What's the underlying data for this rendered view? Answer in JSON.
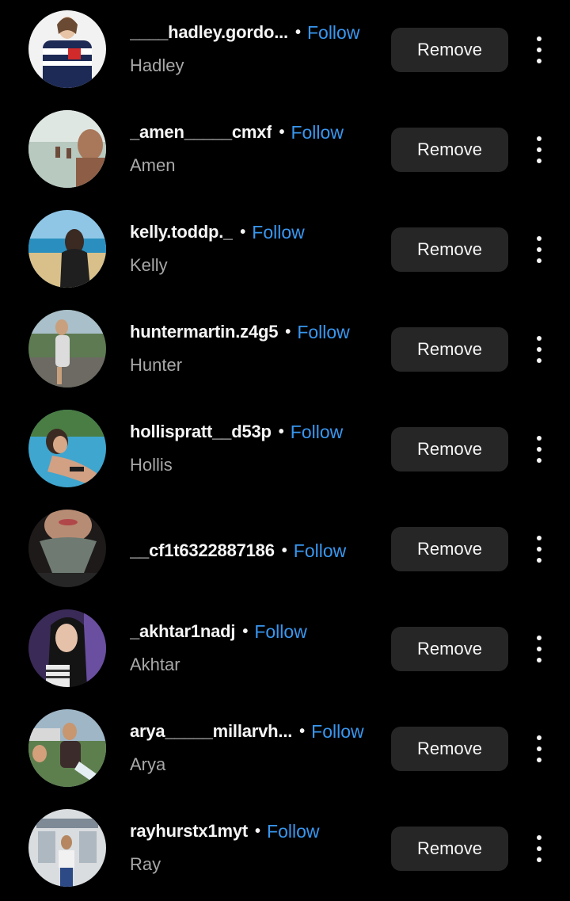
{
  "follow_label": "Follow",
  "remove_label": "Remove",
  "separator": "•",
  "accent_color": "#3897f0",
  "followers": [
    {
      "username": "____hadley.gordo...",
      "name": "Hadley",
      "avatar": "sweater"
    },
    {
      "username": "_amen_____cmxf",
      "name": "Amen",
      "avatar": "beach-selfie"
    },
    {
      "username": "kelly.toddp._",
      "name": "Kelly",
      "avatar": "seaside"
    },
    {
      "username": "huntermartin.z4g5",
      "name": "Hunter",
      "avatar": "garden"
    },
    {
      "username": "hollispratt__d53p",
      "name": "Hollis",
      "avatar": "pool"
    },
    {
      "username": "__cf1t6322887186",
      "name": "",
      "avatar": "scarf"
    },
    {
      "username": "_akhtar1nadj",
      "name": "Akhtar",
      "avatar": "portrait-purple"
    },
    {
      "username": "arya_____millarvh...",
      "name": "Arya",
      "avatar": "outdoor-group"
    },
    {
      "username": "rayhurstx1myt",
      "name": "Ray",
      "avatar": "building"
    }
  ]
}
